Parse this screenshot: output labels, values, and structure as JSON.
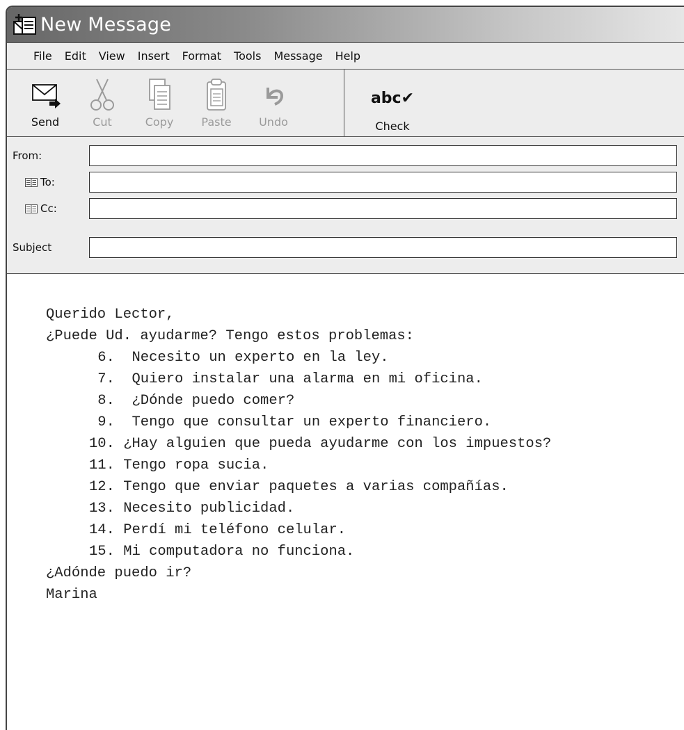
{
  "window": {
    "title": "New Message"
  },
  "menu": [
    "File",
    "Edit",
    "View",
    "Insert",
    "Format",
    "Tools",
    "Message",
    "Help"
  ],
  "toolbar": {
    "send": "Send",
    "cut": "Cut",
    "copy": "Copy",
    "paste": "Paste",
    "undo": "Undo",
    "check_glyph": "abc✔",
    "check": "Check"
  },
  "fields": {
    "from_label": "From:",
    "to_label": "To:",
    "cc_label": "Cc:",
    "subject_label": "Subject",
    "from_value": "",
    "to_value": "",
    "cc_value": "",
    "subject_value": ""
  },
  "message": {
    "greeting": "Querido Lector,",
    "intro": "¿Puede Ud. ayudarme? Tengo estos problemas:",
    "items": [
      " 6.  Necesito un experto en la ley.",
      " 7.  Quiero instalar una alarma en mi oficina.",
      " 8.  ¿Dónde puedo comer?",
      " 9.  Tengo que consultar un experto financiero.",
      "10. ¿Hay alguien que pueda ayudarme con los impuestos?",
      "11. Tengo ropa sucia.",
      "12. Tengo que enviar paquetes a varias compañías.",
      "13. Necesito publicidad.",
      "14. Perdí mi teléfono celular.",
      "15. Mi computadora no funciona."
    ],
    "closing": "¿Adónde puedo ir?",
    "signature": "Marina"
  }
}
